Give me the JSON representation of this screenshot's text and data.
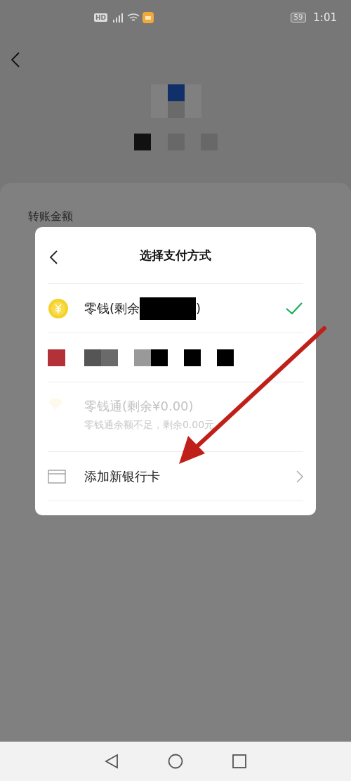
{
  "status_bar": {
    "network_badge": "HD",
    "battery": "59",
    "time": "1:01"
  },
  "sheet": {
    "amount_label": "转账金额"
  },
  "dialog": {
    "title": "选择支付方式",
    "methods": [
      {
        "kind": "wallet",
        "label": "零钱(剩余",
        "label_end": ")",
        "selected": true,
        "disabled": false
      },
      {
        "kind": "bank-card",
        "selected": false,
        "disabled": false
      },
      {
        "kind": "fund",
        "label": "零钱通(剩余¥0.00)",
        "note": "零钱通余额不足，剩余0.00元",
        "selected": false,
        "disabled": true
      },
      {
        "kind": "add-card",
        "label": "添加新银行卡",
        "selected": false,
        "disabled": false
      }
    ]
  }
}
